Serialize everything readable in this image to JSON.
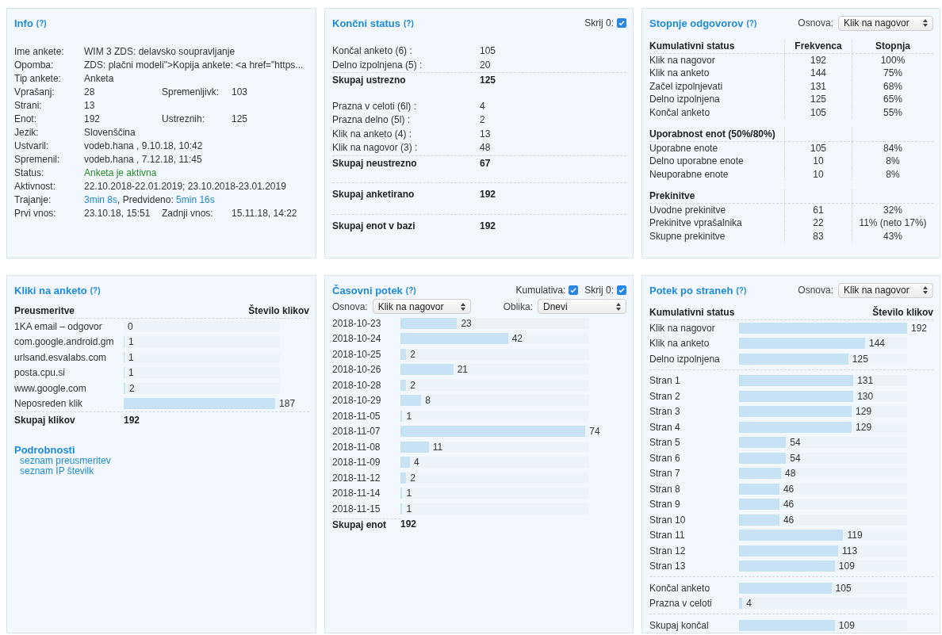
{
  "info": {
    "title": "Info",
    "help": "(?)",
    "rows": [
      {
        "label": "Ime ankete:",
        "parts": [
          {
            "text": "WIM 3 ZDS: delavsko soupravljanje",
            "kind": "plain"
          }
        ]
      },
      {
        "label": "Opomba:",
        "parts": [
          {
            "text": "ZDS: plačni modeli\">Kopija ankete: <a href=\"https...",
            "kind": "plain"
          }
        ]
      },
      {
        "label": "Tip ankete:",
        "parts": [
          {
            "text": "Anketa",
            "kind": "plain"
          }
        ]
      },
      {
        "label": "Vprašanj:",
        "parts": [
          {
            "text": "28",
            "kind": "plain"
          }
        ],
        "label_2": "Spremenljivk:",
        "value_2": "103"
      },
      {
        "label": "Strani:",
        "parts": [
          {
            "text": "13",
            "kind": "plain"
          }
        ]
      },
      {
        "label": "Enot:",
        "parts": [
          {
            "text": "192",
            "kind": "plain"
          }
        ],
        "label_2": "Ustreznih:",
        "value_2": "125"
      },
      {
        "label": "Jezik:",
        "parts": [
          {
            "text": "Slovenščina",
            "kind": "plain"
          }
        ]
      },
      {
        "label": "Ustvaril:",
        "parts": [
          {
            "text": "vodeb.hana , 9.10.18, 10:42",
            "kind": "plain"
          }
        ]
      },
      {
        "label": "Spremenil:",
        "parts": [
          {
            "text": "vodeb.hana , 7.12.18, 11:45",
            "kind": "plain"
          }
        ]
      },
      {
        "label": "Status:",
        "parts": [
          {
            "text": "Anketa je aktivna",
            "kind": "positive"
          }
        ]
      },
      {
        "label": "Aktivnost:",
        "parts": [
          {
            "text": "22.10.2018-22.01.2019; 23.10.2018-23.01.2019",
            "kind": "plain"
          }
        ]
      },
      {
        "label": "Trajanje:",
        "parts": [
          {
            "text": "3min 8s",
            "kind": "link"
          },
          {
            "text": ", Predvideno: ",
            "kind": "plain"
          },
          {
            "text": "5min 16s",
            "kind": "link"
          }
        ]
      },
      {
        "label": "Prvi vnos:",
        "parts": [
          {
            "text": "23.10.18, 15:51",
            "kind": "plain"
          }
        ],
        "label_2": "Zadnji vnos:",
        "value_2": "15.11.18, 14:22"
      }
    ]
  },
  "final_status": {
    "title": "Končni status",
    "help": "(?)",
    "hide_zero": {
      "label": "Skrij 0:",
      "checked": true
    },
    "groups": [
      {
        "rows": [
          {
            "label": "Končal anketo (6) :",
            "value": "105"
          },
          {
            "label": "Delno izpolnjena (5) :",
            "value": "20"
          }
        ],
        "total": {
          "label": "Skupaj ustrezno",
          "value": "125"
        }
      },
      {
        "rows": [
          {
            "label": "Prazna v celoti (6l) :",
            "value": "4"
          },
          {
            "label": "Prazna delno (5l) :",
            "value": "2"
          },
          {
            "label": "Klik na anketo (4) :",
            "value": "13"
          },
          {
            "label": "Klik na nagovor (3) :",
            "value": "48"
          }
        ],
        "total": {
          "label": "Skupaj neustrezno",
          "value": "67"
        }
      },
      {
        "total": {
          "label": "Skupaj anketirano",
          "value": "192"
        }
      },
      {
        "total": {
          "label": "Skupaj enot v bazi",
          "value": "192"
        }
      }
    ]
  },
  "response_rates": {
    "title": "Stopnje odgovorov",
    "help": "(?)",
    "basis_label": "Osnova:",
    "basis": "Klik na nagovor",
    "columns": [
      "Frekvenca",
      "Stopnja"
    ],
    "sections": [
      {
        "title": "Kumulativni status",
        "rows": [
          {
            "label": "Klik na nagovor",
            "frequency": "192",
            "rate": "100%"
          },
          {
            "label": "Klik na anketo",
            "frequency": "144",
            "rate": "75%"
          },
          {
            "label": "Začel izpolnjevati",
            "frequency": "131",
            "rate": "68%"
          },
          {
            "label": "Delno izpolnjena",
            "frequency": "125",
            "rate": "65%"
          },
          {
            "label": "Končal anketo",
            "frequency": "105",
            "rate": "55%"
          }
        ]
      },
      {
        "title": "Uporabnost enot (50%/80%)",
        "rows": [
          {
            "label": "Uporabne enote",
            "frequency": "105",
            "rate": "84%"
          },
          {
            "label": "Delno uporabne enote",
            "frequency": "10",
            "rate": "8%"
          },
          {
            "label": "Neuporabne enote",
            "frequency": "10",
            "rate": "8%"
          }
        ]
      },
      {
        "title": "Prekinitve",
        "rows": [
          {
            "label": "Uvodne prekinitve",
            "frequency": "61",
            "rate": "32%"
          },
          {
            "label": "Prekinitve vprašalnika",
            "frequency": "22",
            "rate": "11% (neto 17%)"
          },
          {
            "label": "Skupne prekinitve",
            "frequency": "83",
            "rate": "43%"
          }
        ]
      }
    ]
  },
  "clicks": {
    "title": "Kliki na anketo",
    "help": "(?)",
    "columns": [
      "Preusmeritve",
      "Število klikov"
    ],
    "rows": [
      {
        "label": "1KA email – odgovor",
        "value": "0"
      },
      {
        "label": "com.google.android.gm",
        "value": "1",
        "level": 0.005
      },
      {
        "label": "urlsand.esvalabs.com",
        "value": "1",
        "level": 0.005
      },
      {
        "label": "posta.cpu.si",
        "value": "1",
        "level": 0.005
      },
      {
        "label": "www.google.com",
        "value": "2",
        "level": 0.01
      },
      {
        "label": "Neposreden klik",
        "value": "187",
        "level": 0.97
      }
    ],
    "total": {
      "label": "Skupaj klikov",
      "value": "192"
    },
    "details_title": "Podrobnosti",
    "details_links": [
      "seznam preusmeritev",
      "seznam IP številk"
    ]
  },
  "timeline": {
    "title": "Časovni potek",
    "help": "(?)",
    "cumulative": {
      "label": "Kumulativa:",
      "checked": true
    },
    "hide_zero": {
      "label": "Skrij 0:",
      "checked": true
    },
    "basis_label": "Osnova:",
    "basis": "Klik na nagovor",
    "form_label": "Oblika:",
    "form": "Dnevi",
    "rows": [
      {
        "label": "2018-10-23",
        "value": "23",
        "level": 0.3
      },
      {
        "label": "2018-10-24",
        "value": "42",
        "level": 0.57
      },
      {
        "label": "2018-10-25",
        "value": "2",
        "level": 0.03
      },
      {
        "label": "2018-10-26",
        "value": "21",
        "level": 0.28
      },
      {
        "label": "2018-10-28",
        "value": "2",
        "level": 0.03
      },
      {
        "label": "2018-10-29",
        "value": "8",
        "level": 0.11
      },
      {
        "label": "2018-11-05",
        "value": "1",
        "level": 0.01
      },
      {
        "label": "2018-11-07",
        "value": "74",
        "level": 0.98
      },
      {
        "label": "2018-11-08",
        "value": "11",
        "level": 0.15
      },
      {
        "label": "2018-11-09",
        "value": "4",
        "level": 0.05
      },
      {
        "label": "2018-11-12",
        "value": "2",
        "level": 0.03
      },
      {
        "label": "2018-11-14",
        "value": "1",
        "level": 0.01
      },
      {
        "label": "2018-11-15",
        "value": "1",
        "level": 0.01
      }
    ],
    "total": {
      "label": "Skupaj enot",
      "value": "192"
    }
  },
  "page_flow": {
    "title": "Potek po straneh",
    "help": "(?)",
    "basis_label": "Osnova:",
    "basis": "Klik na nagovor",
    "columns": [
      "Kumulativni status",
      "Število klikov"
    ],
    "groups": [
      [
        {
          "label": "Klik na nagovor",
          "value": "192",
          "level": 1
        },
        {
          "label": "Klik na anketo",
          "value": "144",
          "level": 0.75
        },
        {
          "label": "Delno izpolnjena",
          "value": "125",
          "level": 0.65
        }
      ],
      [
        {
          "label": "Stran 1",
          "value": "131",
          "level": 0.68
        },
        {
          "label": "Stran 2",
          "value": "130",
          "level": 0.68
        },
        {
          "label": "Stran 3",
          "value": "129",
          "level": 0.67
        },
        {
          "label": "Stran 4",
          "value": "129",
          "level": 0.67
        },
        {
          "label": "Stran 5",
          "value": "54",
          "level": 0.28
        },
        {
          "label": "Stran 6",
          "value": "54",
          "level": 0.28
        },
        {
          "label": "Stran 7",
          "value": "48",
          "level": 0.25
        },
        {
          "label": "Stran 8",
          "value": "46",
          "level": 0.24
        },
        {
          "label": "Stran 9",
          "value": "46",
          "level": 0.24
        },
        {
          "label": "Stran 10",
          "value": "46",
          "level": 0.24
        },
        {
          "label": "Stran 11",
          "value": "119",
          "level": 0.62
        },
        {
          "label": "Stran 12",
          "value": "113",
          "level": 0.59
        },
        {
          "label": "Stran 13",
          "value": "109",
          "level": 0.57
        }
      ],
      [
        {
          "label": "Končal anketo",
          "value": "105",
          "level": 0.55
        },
        {
          "label": "Prazna v celoti",
          "value": "4",
          "level": 0.02
        }
      ],
      [
        {
          "label": "Skupaj končal",
          "value": "109",
          "level": 0.57
        }
      ]
    ]
  }
}
